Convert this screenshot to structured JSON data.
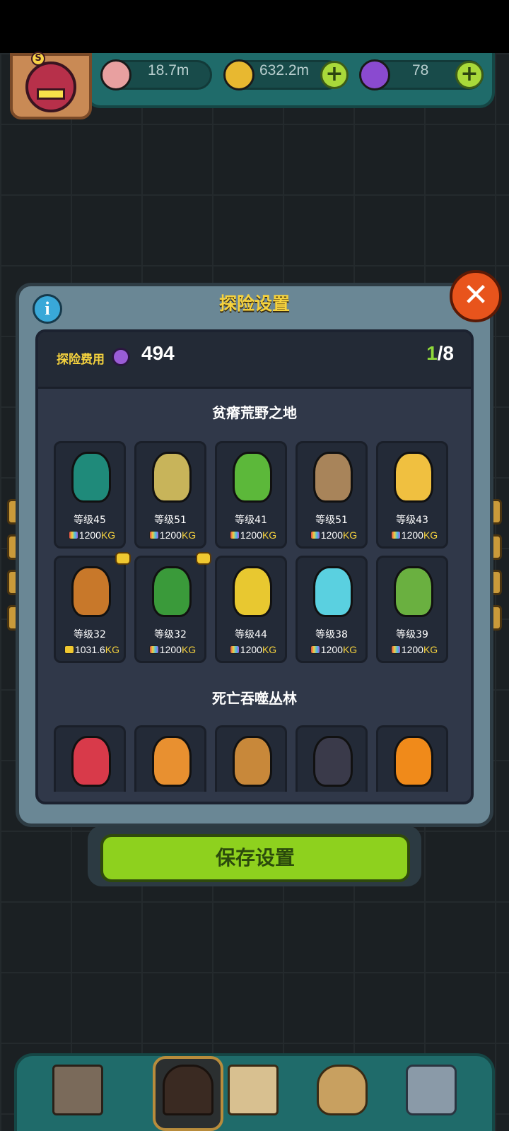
{
  "resources": {
    "eyeballs": "18.7m",
    "coins": "632.2m",
    "potions": "78",
    "plus": "+"
  },
  "dialog": {
    "title": "探险设置",
    "info": "i",
    "close": "✕",
    "cost_label": "探险费用",
    "cost_value": "494",
    "count_current": "1",
    "count_total": "/8"
  },
  "regions": [
    {
      "title": "贫瘠荒野之地",
      "creatures": [
        {
          "icon": "green-bird-icon",
          "level": "等级45",
          "weight": "1200",
          "unit": "KG",
          "color": "#1f8a7a"
        },
        {
          "icon": "wheat-plant-icon",
          "level": "等级51",
          "weight": "1200",
          "unit": "KG",
          "color": "#c8b45a"
        },
        {
          "icon": "lettuce-icon",
          "level": "等级41",
          "weight": "1200",
          "unit": "KG",
          "color": "#5cb83a"
        },
        {
          "icon": "potato-creature-icon",
          "level": "等级51",
          "weight": "1200",
          "unit": "KG",
          "color": "#a8845a"
        },
        {
          "icon": "chicken-icon",
          "level": "等级43",
          "weight": "1200",
          "unit": "KG",
          "color": "#f0c040"
        }
      ]
    },
    {
      "creatures": [
        {
          "icon": "yak-icon",
          "level": "等级32",
          "weight": "1031.6",
          "unit": "KG",
          "color": "#c8782a",
          "gold": true,
          "badge": true
        },
        {
          "icon": "tree-creature-icon",
          "level": "等级32",
          "weight": "1200",
          "unit": "KG",
          "color": "#3a9a3a",
          "badge": true
        },
        {
          "icon": "corn-icon",
          "level": "等级44",
          "weight": "1200",
          "unit": "KG",
          "color": "#e8c830"
        },
        {
          "icon": "ghost-icon",
          "level": "等级38",
          "weight": "1200",
          "unit": "KG",
          "color": "#5ad0e0"
        },
        {
          "icon": "cactus-icon",
          "level": "等级39",
          "weight": "1200",
          "unit": "KG",
          "color": "#6ab040"
        }
      ]
    },
    {
      "title": "死亡吞噬丛林",
      "creatures": [
        {
          "icon": "red-frog-icon",
          "color": "#d83a4a"
        },
        {
          "icon": "mushroom-cow-icon",
          "color": "#e89030"
        },
        {
          "icon": "monkey-icon",
          "color": "#c8883a"
        },
        {
          "icon": "chainsaw-pig-icon",
          "color": "#3a3a4a"
        },
        {
          "icon": "pumpkin-icon",
          "color": "#f08a1a"
        }
      ]
    }
  ],
  "save_button": "保存设置",
  "nav": [
    "shop-icon",
    "expedition-icon",
    "book-icon",
    "bag-icon",
    "menu-grid-icon"
  ]
}
